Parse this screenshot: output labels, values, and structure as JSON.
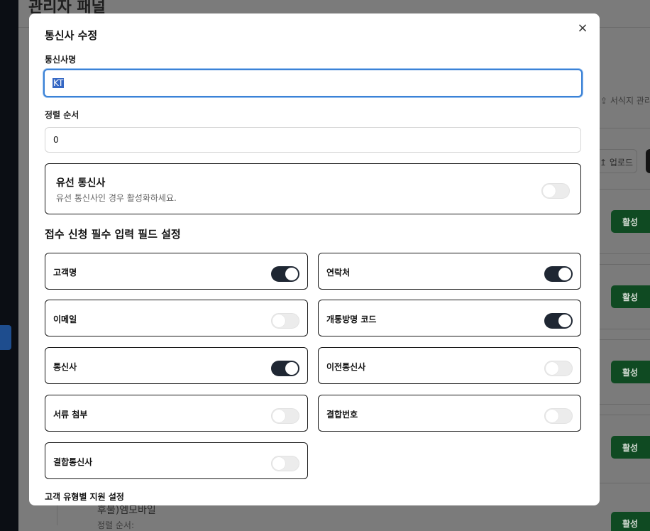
{
  "background": {
    "title": "관리자 패널",
    "link_text": "서식지 관리",
    "upload_label": "업로드",
    "status_badges": [
      "활성",
      "활성",
      "활성",
      "활성",
      "활성"
    ],
    "item_title": "후불)엠모바일",
    "item_sub": "정렬 순서:"
  },
  "modal": {
    "title": "통신사 수정",
    "close_icon": "×",
    "name_label": "통신사명",
    "name_value": "KT",
    "sort_label": "정렬 순서",
    "sort_value": "0",
    "wired": {
      "title": "유선 통신사",
      "description": "유선 통신사인 경우 활성화하세요.",
      "enabled": false
    },
    "required_section_title": "접수 신청 필수 입력 필드 설정",
    "fields": [
      {
        "label": "고객명",
        "enabled": true
      },
      {
        "label": "연락처",
        "enabled": true
      },
      {
        "label": "이메일",
        "enabled": false
      },
      {
        "label": "개통방명 코드",
        "enabled": true
      },
      {
        "label": "통신사",
        "enabled": true
      },
      {
        "label": "이전통신사",
        "enabled": false
      },
      {
        "label": "서류 첨부",
        "enabled": false
      },
      {
        "label": "결합번호",
        "enabled": false
      },
      {
        "label": "결합통신사",
        "enabled": false
      }
    ],
    "customer_type_title": "고객 유형별 지원 설정"
  },
  "colors": {
    "accent": "#3b82d6",
    "toggle_on": "#1f2733",
    "badge_green": "#0f4a22"
  }
}
